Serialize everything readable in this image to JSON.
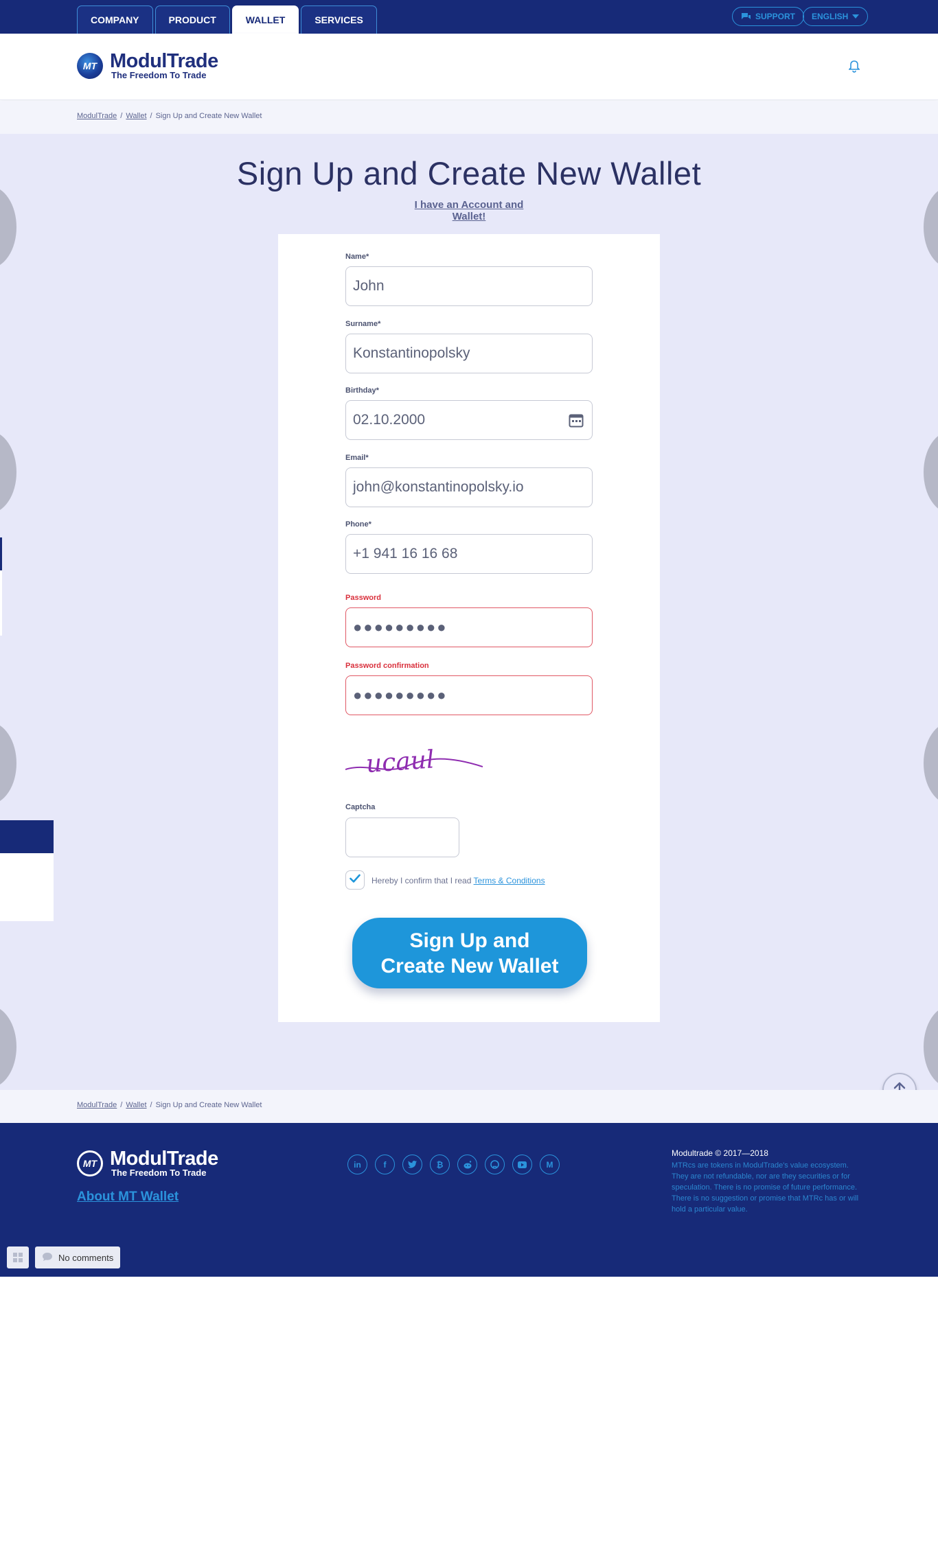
{
  "topnav": {
    "tabs": [
      {
        "label": "COMPANY"
      },
      {
        "label": "PRODUCT"
      },
      {
        "label": "WALLET",
        "active": true
      },
      {
        "label": "SERVICES"
      }
    ],
    "support_label": "SUPPORT",
    "language_label": "ENGLISH"
  },
  "brand": {
    "mark": "MT",
    "name": "ModulTrade",
    "tagline": "The Freedom To Trade"
  },
  "breadcrumb": {
    "items": [
      "ModulTrade",
      "Wallet",
      "Sign Up and Create New Wallet"
    ],
    "separator": "/"
  },
  "page": {
    "title": "Sign Up and Create New Wallet",
    "account_link": "I have an Account and Wallet!"
  },
  "form": {
    "name": {
      "label": "Name*",
      "value": "John"
    },
    "surname": {
      "label": "Surname*",
      "value": "Konstantinopolsky"
    },
    "birthday": {
      "label": "Birthday*",
      "value": "02.10.2000"
    },
    "email": {
      "label": "Email*",
      "value": "john@konstantinopolsky.io"
    },
    "phone": {
      "label": "Phone*",
      "value": "+1 941 16 16 68"
    },
    "password": {
      "label": "Password",
      "value": "●●●●●●●●●",
      "state": "error"
    },
    "password_confirmation": {
      "label": "Password confirmation",
      "value": "●●●●●●●●●",
      "state": "error"
    },
    "captcha_text": "ucaul",
    "captcha": {
      "label": "Captcha",
      "value": ""
    },
    "terms": {
      "text": "Hereby I confirm that I read",
      "link": "Terms & Conditions",
      "checked": true
    },
    "submit_line1": "Sign Up and",
    "submit_line2": "Create New Wallet"
  },
  "footer": {
    "about_link": "About MT Wallet",
    "socials": [
      "linkedin-icon",
      "facebook-icon",
      "twitter-icon",
      "bitcointalk-icon",
      "reddit-icon",
      "github-icon",
      "youtube-icon",
      "medium-icon"
    ],
    "copyright": "Modultrade © 2017—2018",
    "disclaimer": "MTRcs are tokens in ModulTrade's value ecosystem. They are not refundable, nor are they securities or for speculation. There is no promise of future performance. There is no suggestion or promise that MTRc has or will hold a particular value."
  },
  "tools": {
    "comments_label": "No comments"
  },
  "colors": {
    "navy": "#172a78",
    "accent": "#1e96da",
    "page_bg": "#e7e8f9",
    "error": "#d9303c"
  }
}
